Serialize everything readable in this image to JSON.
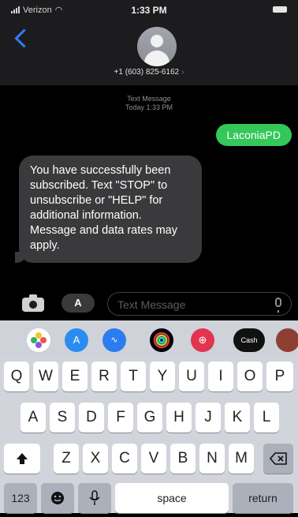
{
  "status_bar": {
    "carrier": "Verizon",
    "time": "1:33 PM"
  },
  "contact": {
    "number": "+1 (603) 825-6162",
    "chevron": "›"
  },
  "conversation": {
    "meta_line1": "Text Message",
    "meta_line2": "Today 1:33 PM",
    "sent_message": "LaconiaPD",
    "received_message": "You have successfully been subscribed. Text \"STOP\" to unsubscribe or \"HELP\" for additional information. Message and data rates may apply."
  },
  "input": {
    "placeholder": "Text Message",
    "apps_label": "A"
  },
  "app_drawer": {
    "apps": [
      {
        "icon": "photos-icon",
        "label": ""
      },
      {
        "icon": "app-store-icon",
        "label": "A"
      },
      {
        "icon": "audio-message-icon",
        "label": ""
      },
      {
        "icon": "activity-icon",
        "label": ""
      },
      {
        "icon": "search-images-icon",
        "label": ""
      },
      {
        "icon": "apple-cash-icon",
        "label": "Cash"
      },
      {
        "icon": "memoji-icon",
        "label": ""
      }
    ]
  },
  "keyboard": {
    "row1": [
      "Q",
      "W",
      "E",
      "R",
      "T",
      "Y",
      "U",
      "I",
      "O",
      "P"
    ],
    "row2": [
      "A",
      "S",
      "D",
      "F",
      "G",
      "H",
      "J",
      "K",
      "L"
    ],
    "row3": [
      "Z",
      "X",
      "C",
      "V",
      "B",
      "N",
      "M"
    ],
    "numbers_label": "123",
    "space_label": "space",
    "return_label": "return"
  }
}
